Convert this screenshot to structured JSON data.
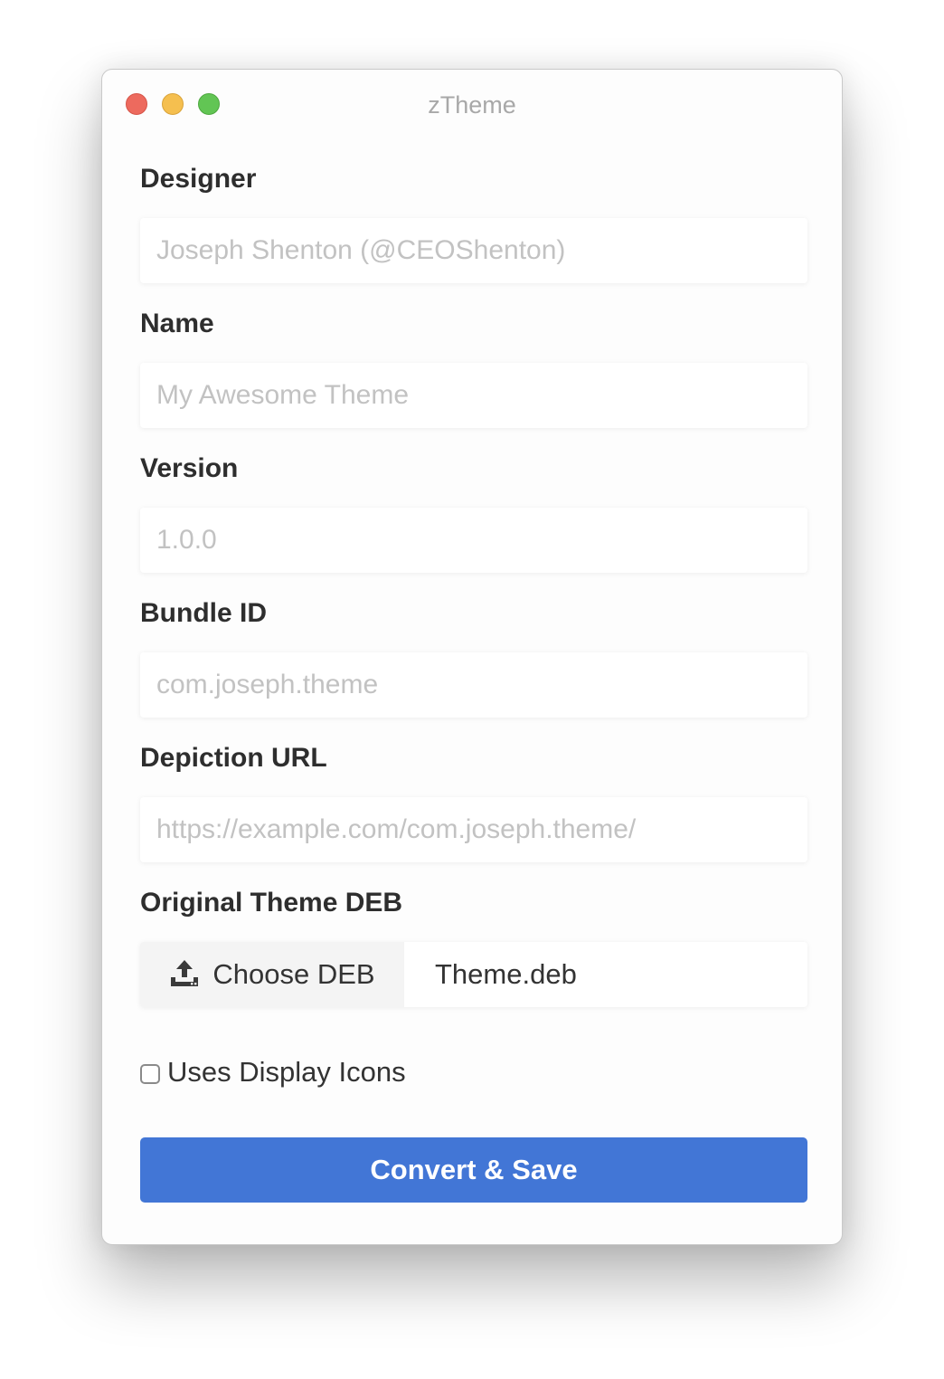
{
  "window": {
    "title": "zTheme"
  },
  "form": {
    "designer": {
      "label": "Designer",
      "placeholder": "Joseph Shenton (@CEOShenton)",
      "value": ""
    },
    "name": {
      "label": "Name",
      "placeholder": "My Awesome Theme",
      "value": ""
    },
    "version": {
      "label": "Version",
      "placeholder": "1.0.0",
      "value": ""
    },
    "bundle_id": {
      "label": "Bundle ID",
      "placeholder": "com.joseph.theme",
      "value": ""
    },
    "depiction_url": {
      "label": "Depiction URL",
      "placeholder": "https://example.com/com.joseph.theme/",
      "value": ""
    },
    "original_deb": {
      "label": "Original Theme DEB",
      "button_label": "Choose DEB",
      "button_icon": "upload-icon",
      "file_name": "Theme.deb"
    },
    "display_icons": {
      "label": "Uses Display Icons",
      "checked": false
    },
    "submit_label": "Convert & Save"
  },
  "colors": {
    "accent": "#4276d6",
    "close": "#ed6a5e",
    "minimize": "#f5bf4f",
    "maximize": "#62c554"
  }
}
